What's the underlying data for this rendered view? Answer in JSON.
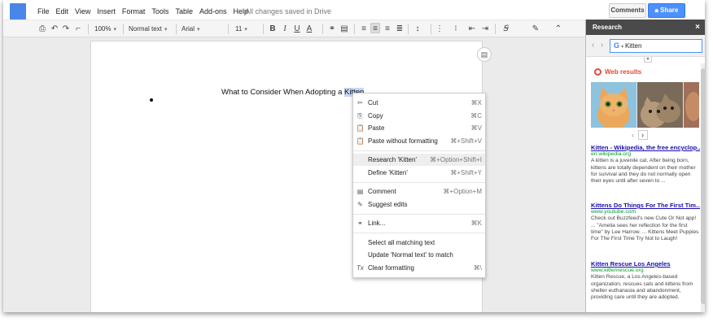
{
  "menubar": {
    "items": [
      "File",
      "Edit",
      "View",
      "Insert",
      "Format",
      "Tools",
      "Table",
      "Add-ons",
      "Help"
    ],
    "save_status": "All changes saved in Drive"
  },
  "header": {
    "comments_label": "Comments",
    "share_label": "Share"
  },
  "toolbar": {
    "zoom": "100%",
    "style": "Normal text",
    "font": "Arial",
    "size": "11",
    "bold": "B",
    "italic": "I",
    "underline": "U",
    "text_color": "A"
  },
  "document": {
    "title_prefix": "What to Consider When Adopting a ",
    "title_selected": "Kitten"
  },
  "context_menu": {
    "items": [
      {
        "icon": "✂",
        "label": "Cut",
        "shortcut": "⌘X"
      },
      {
        "icon": "⎘",
        "label": "Copy",
        "shortcut": "⌘C"
      },
      {
        "icon": "📋",
        "label": "Paste",
        "shortcut": "⌘V"
      },
      {
        "icon": "📋",
        "label": "Paste without formatting",
        "shortcut": "⌘+Shift+V"
      },
      {
        "icon": "",
        "label": "Research 'Kitten'",
        "shortcut": "⌘+Option+Shift+I"
      },
      {
        "icon": "",
        "label": "Define 'Kitten'",
        "shortcut": "⌘+Shift+Y"
      },
      {
        "icon": "▤",
        "label": "Comment",
        "shortcut": "⌘+Option+M"
      },
      {
        "icon": "✎",
        "label": "Suggest edits",
        "shortcut": ""
      },
      {
        "icon": "⚭",
        "label": "Link...",
        "shortcut": "⌘K"
      },
      {
        "icon": "",
        "label": "Select all matching text",
        "shortcut": ""
      },
      {
        "icon": "",
        "label": "Update 'Normal text' to match",
        "shortcut": ""
      },
      {
        "icon": "Tx",
        "label": "Clear formatting",
        "shortcut": "⌘\\"
      }
    ]
  },
  "research": {
    "title": "Research",
    "close": "×",
    "query": "Kitten",
    "google_mark": "G",
    "web_results_label": "Web results",
    "results": [
      {
        "title": "Kitten - Wikipedia, the free encyclop...",
        "url": "en.wikipedia.org",
        "snippet": "A kitten is a juvenile cat. After being born, kittens are totally dependent on their mother for survival and they do not normally open their eyes until after seven to ..."
      },
      {
        "title": "Kittens Do Things For The First Tim...",
        "url": "www.youtube.com",
        "snippet": "Check out Buzzfeed's new Cute Or Not app! ... \"Amelia sees her reflection for the first time\" by Lee Harrow. ... Kittens Meet Puppies For The First Time Try Not to Laugh!"
      },
      {
        "title": "Kitten Rescue Los Angeles",
        "url": "www.kittenrescue.org",
        "snippet": "Kitten Rescue, a Los Angeles-based organization, rescues cats and kittens from shelter euthanasia and abandonment, providing care until they are adopted."
      }
    ]
  },
  "colors": {
    "accent": "#4d90fe",
    "panel_header": "#4a4a4a",
    "link": "#1a0dab",
    "url": "#009933",
    "web_results": "#dd4b39"
  }
}
